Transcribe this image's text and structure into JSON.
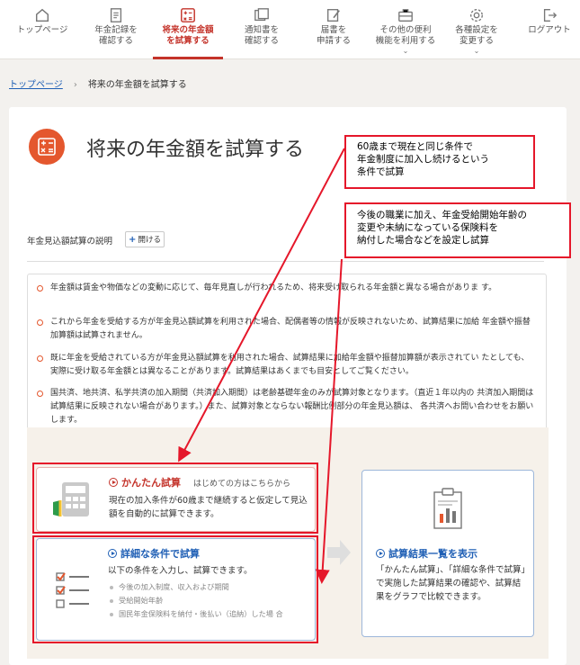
{
  "nav": {
    "items": [
      {
        "label": "トップページ",
        "icon": "home-icon"
      },
      {
        "label": "年金記録を\n確認する",
        "icon": "document-icon"
      },
      {
        "label": "将来の年金額\nを試算する",
        "icon": "calculator-icon",
        "active": true
      },
      {
        "label": "通知書を\n確認する",
        "icon": "notice-icon"
      },
      {
        "label": "届書を\n申請する",
        "icon": "form-pen-icon"
      },
      {
        "label": "その他の便利\n機能を利用する",
        "icon": "toolbox-icon",
        "dropdown": true
      },
      {
        "label": "各種設定を\n変更する",
        "icon": "gear-icon",
        "dropdown": true
      },
      {
        "label": "ログアウト",
        "icon": "logout-icon"
      }
    ]
  },
  "breadcrumb": {
    "home": "トップページ",
    "separator": "›",
    "current": "将来の年金額を試算する"
  },
  "page": {
    "title": "将来の年金額を試算する"
  },
  "explanation": {
    "label": "年金見込額試算の説明",
    "open_button": "開ける"
  },
  "notes": [
    "年金額は賃金や物価などの変動に応じて、毎年見直しが行われるため、将来受け取られる年金額と異なる場合がありま す。",
    "これから年金を受給する方が年金見込額試算を利用された場合、配偶者等の情報が反映されないため、試算結果に加給 年金額や振替加算額は試算されません。",
    "既に年金を受給されている方が年金見込額試算を利用された場合、試算結果に加給年金額や振替加算額が表示されてい たとしても、実際に受け取る年金額とは異なることがあります。試算結果はあくまでも目安としてご覧ください。",
    "国共済、地共済、私学共済の加入期間（共済加入期間）は老齢基礎年金のみが試算対象となります。（直近１年以内の 共済加入期間は試算結果に反映されない場合があります。）また、試算対象とならない報酬比例部分の年金見込額は、 各共済へお問い合わせをお願いします。"
  ],
  "options": {
    "easy": {
      "title": "かんたん試算",
      "subtitle": "はじめての方はこちらから",
      "description": "現在の加入条件が60歳まで継続すると仮定して見込額を自動的に試算できます。"
    },
    "detail": {
      "title": "詳細な条件で試算",
      "intro": "以下の条件を入力し、試算できます。",
      "items": [
        "今後の加入制度、収入および期間",
        "受給開始年齢",
        "国民年金保険料を納付・後払い（追納）した場 合"
      ]
    },
    "results": {
      "title": "試算結果一覧を表示",
      "description": "「かんたん試算」、「詳細な条件で試算」で実施した試算結果の確認や、試算結果をグラフで比較できます。"
    }
  },
  "annotations": {
    "easy_note": "60歳まで現在と同じ条件で\n年金制度に加入し続けるという\n条件で試算",
    "detail_note": "今後の職業に加え、年金受給開始年齢の\n変更や未納になっている保険料を\n納付した場合などを設定し試算"
  },
  "colors": {
    "accent": "#c4332a",
    "link": "#1f5fb5",
    "annotation": "#e5172a",
    "icon_orange": "#e4572e"
  }
}
